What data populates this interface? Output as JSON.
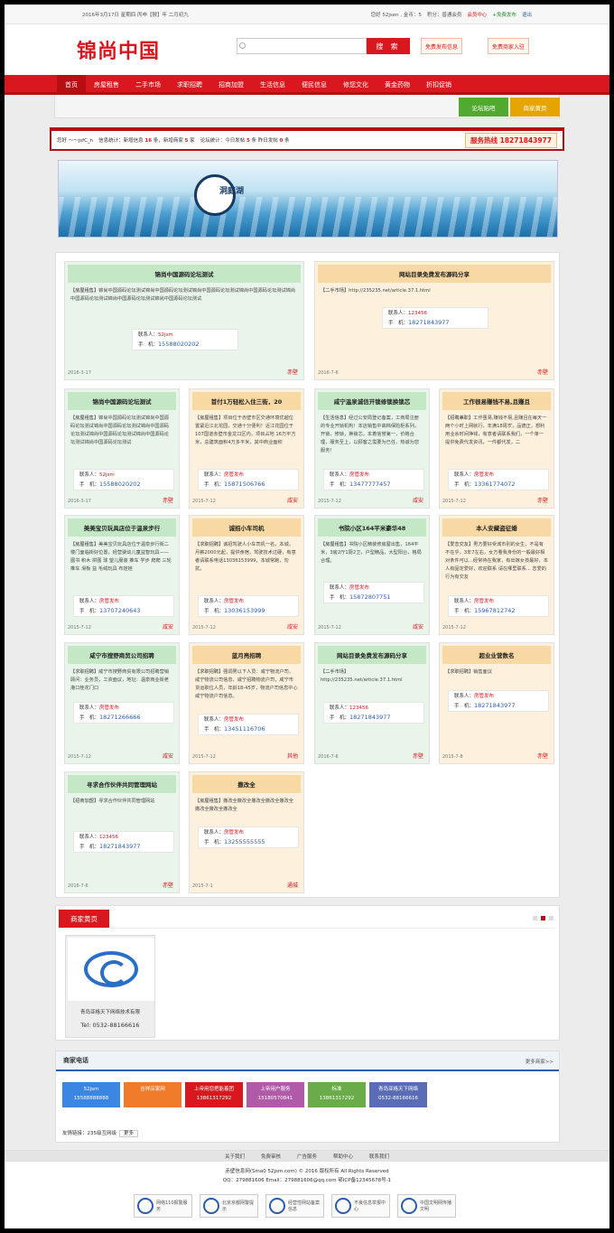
{
  "topbar": {
    "date": "2016年3月17日 星期四 丙申【猴】年 二月初九",
    "welcome": "您好 52jsen , 金币：5",
    "points": "积分：普通会员",
    "center": "会员中心",
    "post": "+免费发布",
    "logout": "退出"
  },
  "header": {
    "logo": "锦尚中国",
    "search_placeholder": "",
    "search_button": "搜 索",
    "btn_post": "免费发布信息",
    "btn_shop": "免费商家入驻"
  },
  "nav": [
    "首页",
    "房屋租售",
    "二手市场",
    "求职招聘",
    "招商加盟",
    "生活信息",
    "便民信息",
    "修您文化",
    "黄金药物",
    "折扣促销"
  ],
  "subnav": {
    "forum": "论坛贴吧",
    "shops": "商家黄页"
  },
  "stats": {
    "user": "您好 ～～jsfC_n",
    "s1": "信息统计：新增信息",
    "s1v": "16",
    "s2": "条，新增商家",
    "s2v": "5",
    "s3": "家",
    "s4": "论坛统计：今日发帖",
    "s4v": "5",
    "s5": "条 昨日发帖",
    "s5v": "0",
    "s6": "条",
    "hot": "服务热线 18271843977"
  },
  "banner": {
    "text": "洞庭湖"
  },
  "cards": [
    {
      "title": "锦尚中国源码论坛测试",
      "cat": "【房屋租售】",
      "desc": "锦尚中国源码论坛测试锦尚中国源码论坛测试锦尚中国源码论坛测试锦尚中国源码论坛测试锦尚中国源码论坛测试锦尚中国源码论坛测试锦尚中国源码论坛测试",
      "who": "52jsm",
      "phone": "15588020202",
      "date": "2016-3-17",
      "loc": "赤壁"
    },
    {
      "title": "网站目录免费发布源码分享",
      "cat": "【二手市场】",
      "desc": "http://235235.net/article.37.1.html",
      "who": "123456",
      "phone": "18271843977",
      "date": "2016-7-6",
      "loc": "赤壁"
    },
    {
      "title": "锦尚中国源码论坛测试",
      "cat": "【房屋租售】",
      "desc": "锦尚中国源码论坛测试锦尚中国源码论坛测试锦尚中国源码论坛测试锦尚中国源码论坛测试锦尚中国源码论坛测试锦尚中国源码论坛测试锦尚中国源码论坛测试",
      "who": "52jsm",
      "phone": "15588020202",
      "date": "2016-3-17",
      "loc": "赤壁"
    },
    {
      "title": "首付1万轻松入住三街，20",
      "cat": "【房屋租售】",
      "desc": "项目位于赤壁市区交通环境优越位置紧近江北花园，交通十分便利！近江花园位于107国道赤壁市金龙口区内，项目占地 16万平方米，总建筑面积4万多平米，其中商业面积",
      "who": "房管发布",
      "phone": "15871506766",
      "date": "2015-7-12",
      "loc": "咸安"
    },
    {
      "title": "咸宁温泉诚信开锁修锁换锁芯",
      "cat": "【生活信息】",
      "desc": "经过公安局登记备案，工商局注册的专业开锁机构！本店销售中高档保险柜系列，开锁，修锁，换锁芯，本着信誉第一，价格合理，服务至上，以顾客之需要为已任，热诚为您服务！",
      "who": "房管发布",
      "phone": "13477777457",
      "date": "2015-7-12",
      "loc": "咸安"
    },
    {
      "title": "工作很易赚钱不易,且赚且",
      "cat": "【招聘兼职】",
      "desc": "工作虽易,赚钱不易,且赚且在每天一两个小时上网就行，年满18周岁，品德正，想利用业余时间挣钱，有意者请联系我们，一个单一提供免费代发资讯，一件都代发，二",
      "who": "房管发布",
      "phone": "13361774072",
      "date": "2015-7-12",
      "loc": "赤壁"
    },
    {
      "title": "美美宝贝玩具店位于温泉步行",
      "cat": "【房屋租售】",
      "desc": "美美宝贝玩具店位于温泉步行街二楼门面临街好位置，经营婴幼儿童益智玩具——图书 积木 拼图 球 望儿服装 推车 学步 爬爬 三轮推车 滑板 益 毛绒玩具 布娃娃",
      "who": "房管发布",
      "phone": "13707240643",
      "date": "2015-7-12",
      "loc": "咸安"
    },
    {
      "title": "诚招小车司机",
      "cat": "【求职招聘】",
      "desc": "诚招驾驶人小车司机一名，本城，月薪2000元起，提供食宿，驾驶技术过硬，有意者请联系电话13036153999，本城常跑，勿扰。",
      "who": "房管发布",
      "phone": "13036153999",
      "date": "2015-7-12",
      "loc": "咸安"
    },
    {
      "title": "书院小区164平米豪华48",
      "cat": "【房屋租售】",
      "desc": "书院小区精装修房屋出售，164平米，3房2厅1厨2卫，户型精品，大型阳台，格局合理。",
      "who": "房管发布",
      "phone": "15872807751",
      "date": "2015-7-12",
      "loc": "咸安"
    },
    {
      "title": "本人安藏盗征婚",
      "cat": "【爱恋交友】",
      "desc": "男方要好受城市别的女生，不是有不在乎，3年7左右，女方看我身份的一般最好相对条件可以...经常待在我家，有出嫁女孩最好，本人有固定爱好，欢迎联系 请在哪里联系... 恋爱的行为有交友",
      "who": "房管发布",
      "phone": "15967812742",
      "date": "2015-7-12",
      "loc": ""
    },
    {
      "title": "咸宁市搜野商贸公司招聘",
      "cat": "【求职招聘】",
      "desc": "咸宁市搜野商贸有限公司招聘营销顾问：业务员，工资面议，地址：温泉商业街老港口桂花门口",
      "who": "房管发布",
      "phone": "18271266666",
      "date": "2015-7-12",
      "loc": "咸安"
    },
    {
      "title": "蓝月亮招聘",
      "cat": "【求职招聘】",
      "desc": "强调男以下人员：咸宁物流户司，咸宁物流公司信息，咸宁招聘物流户司，咸宁市货运职位人员，年龄18-45岁，物流户司信息中心 咸宁物流户司信息。",
      "who": "房管发布",
      "phone": "13451116706",
      "date": "2015-7-12",
      "loc": "其他"
    },
    {
      "title": "网站目录免费发布源码分享",
      "cat": "【二手市场】",
      "desc": "http://235235.net/article.37.1.html",
      "who": "123456",
      "phone": "18271843977",
      "date": "2016-7-6",
      "loc": "赤壁"
    },
    {
      "title": "超业业营数名",
      "cat": "【求职招聘】",
      "desc": "销售面议",
      "who": "房管发布",
      "phone": "18271843977",
      "date": "2015-7-8",
      "loc": "赤壁"
    },
    {
      "title": "寻求合作伙伴共同管理网站",
      "cat": "【招商加盟】",
      "desc": "寻求合作伙伴共同管理网站",
      "who": "123456",
      "phone": "18271843977",
      "date": "2016-7-6",
      "loc": "赤壁"
    },
    {
      "title": "撒改全",
      "cat": "【房屋租售】",
      "desc": "撒改全撒改全撒改全撒改全撒改全撒改全撒改全撒改全",
      "who": "房管发布",
      "phone": "13255555555",
      "date": "2015-7-1",
      "loc": "通城"
    }
  ],
  "shop": {
    "tab": "商家黄页",
    "name": "青岛亚格天下网络技术有限",
    "tel": "Tel: 0532-88166616"
  },
  "phones": {
    "title": "商家电话",
    "more": "更多商家>>",
    "boxes": [
      {
        "n": "52jsm",
        "p": "15588888888"
      },
      {
        "n": "吉祥店家网",
        "p": ""
      },
      {
        "n": "上帝用您把能着团",
        "p": "13861317292"
      },
      {
        "n": "上帝用户服务",
        "p": "15180570841"
      },
      {
        "n": "标准",
        "p": "13861317292"
      },
      {
        "n": "青岛亚格天下网络",
        "p": "0532-88166616"
      }
    ],
    "links_label": "友情链接：235级互网级",
    "links_more": "更多"
  },
  "footer": {
    "nav": [
      "关于我们",
      "免费审核",
      "广告服务",
      "帮助中心",
      "联系我们"
    ],
    "copy1": "赤壁信息网(Sma0 52jsm.com) © 2016 版权所有 All Rights Reserved",
    "copy2": "QQ：279881606 Email：279881606@qq.com 鄂ICP备12345678号-1",
    "badges": [
      "网络110报警服务",
      "北京京都网警提示",
      "经营性网站备案信息",
      "不良信息举报中心",
      "中国文明网传播文明"
    ]
  }
}
